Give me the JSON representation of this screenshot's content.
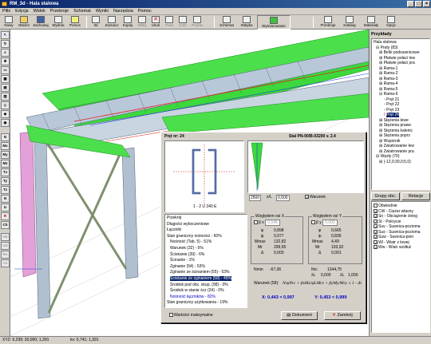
{
  "window": {
    "title": "RM_3d - Hala stalowa",
    "min": "_",
    "max": "□",
    "close": "×"
  },
  "menu": [
    "Pliki",
    "Edycja",
    "Widok",
    "Przekroje",
    "Schemat",
    "Wyniki",
    "Narzędzia",
    "Pomoc"
  ],
  "toolbar": [
    "Nowy",
    "Otwórz",
    "Zachowaj",
    "Wydruk",
    "Pomoc",
    "3d",
    "Zaznacz",
    "Kopiuj",
    "Wklej",
    "Usuń",
    "Powt",
    "Cofn",
    "Ponów",
    "Schemat",
    "Statyka",
    "Wymiarowanie",
    "Przekroje",
    "Katalog",
    "Materiały",
    "Opcje"
  ],
  "left_tools": [
    "N",
    "Mx",
    "My",
    "Mz",
    "Tx",
    "Ty",
    "Tz",
    "N",
    "U",
    "R",
    "Ch",
    "Ob",
    "Od",
    "Ro",
    "Co"
  ],
  "right_panel": {
    "header": "Przykłady",
    "tree": [
      "Hala stalowa",
      "Pręty (83)",
      "Belki podsuwnicowe",
      "Płatwie połaci lew",
      "Płatwie połaci pra",
      "Rama-1",
      "Rama-2",
      "Rama-3",
      "Rama-4",
      "Rama-5",
      "Rama-6",
      "Pręt 21",
      "Pręt 22",
      "Pręt 23",
      "Pręt 24",
      "Stężenia lewe",
      "Stężenia prawe",
      "Stężenia kalenic",
      "Stężenia poprz",
      "Wspornik",
      "Zwiatrowanie lew",
      "Zwiatrowanie pra",
      "Węzły (70)",
      "(-12,0;30,0;5,0)"
    ],
    "tab_groups": "Grupy obc.",
    "tab_relations": "Relacje",
    "envelope": "Obwiednie",
    "loads": [
      {
        "code": "CW",
        "label": "Ciężar własny",
        "checked": true
      },
      {
        "code": "Sn",
        "label": "Obciążenie śnieg",
        "checked": true
      },
      {
        "code": "St",
        "label": "Pokrycie",
        "checked": true
      },
      {
        "code": "Suv",
        "label": "Suwnica-pozioma",
        "checked": true
      },
      {
        "code": "Sus",
        "label": "Suwnica-pozioma",
        "checked": true
      },
      {
        "code": "Suw",
        "label": "Suwnica-pion",
        "checked": true
      },
      {
        "code": "Wl",
        "label": "Wiatr z lewej",
        "checked": true
      },
      {
        "code": "Ww",
        "label": "Wiatr wzdłuż",
        "checked": true
      }
    ]
  },
  "dialog": {
    "title_left": "Pręt nr:  24",
    "title_right": "Stal PN-90/B-03200 v. 2.4",
    "section_label": "1 - 2 U 240 E",
    "scale_value": "2500",
    "scale_unit": "x/L",
    "scale_num": "0,500",
    "warunek": "Warunek",
    "checks": [
      "Przekrój",
      "Długości wyboczeniowe",
      "Łączniki",
      "Stan graniczny nośności - 50%",
      "Nośność (Tab. 5) - 51%",
      "Warunek (32) - 5%",
      "Ściskanie (39) - 6%",
      "Ścinanie - 1%",
      "Zginanie (54) - 53%",
      "Zginanie ze ścinaniem (55) - 53%",
      "Ściskanie ze zginaniem (58) - 45%",
      "Środnik pod obc. skup. (98) - 0%",
      "Środnik w stanie ścz (24) - 0%",
      "Nośność łączników - 82%",
      "Stan graniczny użytkowania - 19%"
    ],
    "x_group": {
      "title": "Względem osi X",
      "beta_label": "β x",
      "beta": "0,548",
      "rows": [
        [
          "φ",
          "0,898"
        ],
        [
          "ψ",
          "0,977"
        ],
        [
          "Mmax",
          "132,82"
        ],
        [
          "Mr",
          "299,65"
        ],
        [
          "Δ",
          "0,003"
        ]
      ]
    },
    "y_group": {
      "title": "Względem osi Y",
      "beta_label": "β y",
      "beta": "0,000",
      "rows": [
        [
          "φ",
          "0,665"
        ],
        [
          "ψ",
          "0,835"
        ],
        [
          "Mmax",
          "4,49"
        ],
        [
          "Mr",
          "103,92"
        ],
        [
          "Δ",
          "0,001"
        ]
      ]
    },
    "nmin_label": "Nmin",
    "nmin": "-67,36",
    "nrc_label": "Nrc",
    "nrc": "1244,75",
    "lambda_label": "λL",
    "lambda": "0,000",
    "lamv_label": "λL",
    "lamv": "1,000",
    "warunek_text": "Warunek (58):",
    "formula": "N/φNrc + βxMx/φLMrx + βyMy/Mry ≤ 1 - Δi",
    "result_x": "X: 0,443 < 0,997",
    "result_y": "Y: 0,453 < 0,999",
    "max_values": "Wartości maksymalne",
    "btn_doc": "Dokument",
    "btn_close": "Zamknij"
  },
  "status": {
    "xyz": "XYZ: 6,299; 30,000; 1,391",
    "kv": "kv: 5,741; 1,391"
  }
}
